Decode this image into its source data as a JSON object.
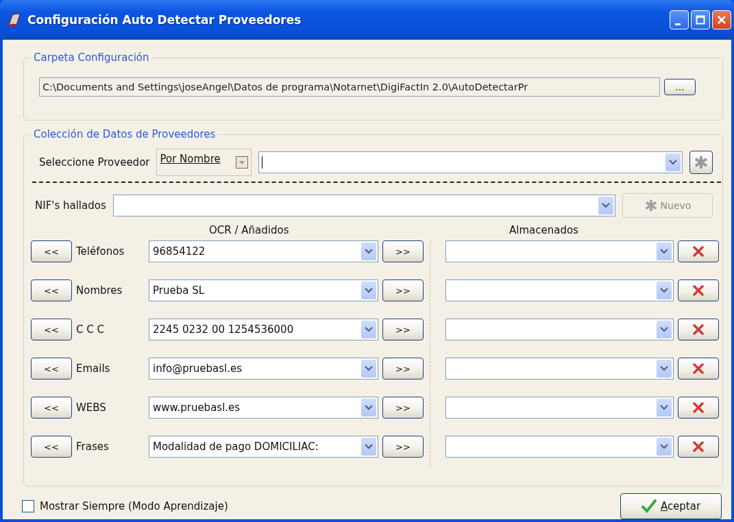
{
  "window": {
    "title": "Configuración Auto Detectar Proveedores"
  },
  "config_folder": {
    "legend": "Carpeta Configuración",
    "path": "C:\\Documents and Settings\\joseAngel\\Datos de programa\\Notarnet\\DigiFactIn 2.0\\AutoDetectarPr",
    "browse_label": "..."
  },
  "providers": {
    "legend": "Colección de Datos de Proveedores",
    "select_label": "Seleccione Proveedor",
    "select_mode": "Por Nombre",
    "nif_label": "NIF's hallados",
    "new_button": {
      "label": "Nuevo",
      "disabled": true
    },
    "ocr_heading": "OCR / Añadidos",
    "stored_heading": "Almacenados",
    "rows": [
      {
        "left": "<<",
        "label": "Teléfonos",
        "value": "96854122",
        "right": ">>"
      },
      {
        "left": "<<",
        "label": "Nombres",
        "value": "Prueba SL",
        "right": ">>"
      },
      {
        "left": "<<",
        "label": "C C C",
        "value": "2245 0232 00 1254536000",
        "right": ">>"
      },
      {
        "left": "<<",
        "label": "Emails",
        "value": "info@pruebasl.es",
        "right": ">>"
      },
      {
        "left": "<<",
        "label": "WEBS",
        "value": "www.pruebasl.es",
        "right": ">>"
      },
      {
        "left": "<<",
        "label": "Frases",
        "value": "Modalidad de pago DOMICILIAC:",
        "right": ">>"
      }
    ]
  },
  "footer": {
    "checkbox": {
      "label": "Mostrar Siempre (Modo Aprendizaje)",
      "checked": false
    },
    "accept_label": "Aceptar"
  }
}
